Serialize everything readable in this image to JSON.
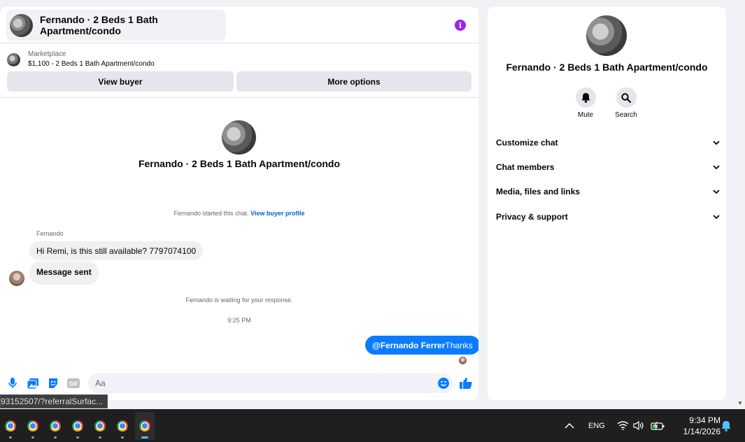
{
  "chat": {
    "title": "Fernando · 2 Beds 1 Bath Apartment/condo",
    "marketplace_label": "Marketplace",
    "listing": "$1,100 - 2 Beds 1 Bath Apartment/condo",
    "view_buyer": "View buyer",
    "more_options": "More options",
    "center_name": "Fernando · 2 Beds 1 Bath Apartment/condo",
    "started_text": "Fernando started this chat.",
    "view_buyer_profile": "View buyer profile",
    "sender": "Fernando",
    "messages_in": [
      "Hi Remi, is this still available? 7797074100",
      "Message sent"
    ],
    "waiting_text": "Fernando is waiting for your response.",
    "timestamp": "9:25 PM",
    "message_out_mention": "@Fernando Ferrer",
    "message_out_text": "Thanks",
    "composer_placeholder": "Aa"
  },
  "details": {
    "name": "Fernando · 2 Beds 1 Bath Apartment/condo",
    "actions": [
      {
        "label": "Mute",
        "icon": "bell-icon"
      },
      {
        "label": "Search",
        "icon": "search-icon"
      }
    ],
    "sections": [
      "Customize chat",
      "Chat members",
      "Media, files and links",
      "Privacy & support"
    ]
  },
  "status_url": "93152507/?referralSurfac...",
  "taskbar": {
    "apps": [
      "chrome-icon",
      "chrome-icon",
      "chrome-icon",
      "chrome-icon",
      "chrome-icon",
      "chrome-icon",
      "chrome-icon"
    ],
    "language": "ENG",
    "time": "9:34 PM",
    "date": "1/14/2026"
  },
  "colors": {
    "accent": "#0a7cff",
    "info_icon": "#a020f0",
    "bubble_in": "#f0f0f0",
    "taskbar": "#1f1f1f"
  }
}
